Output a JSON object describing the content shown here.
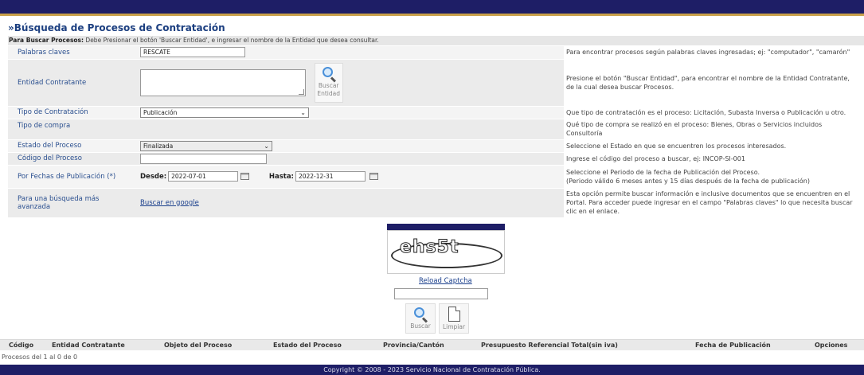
{
  "title": "Búsqueda de Procesos de Contratación",
  "title_prefix": "»",
  "instructions": {
    "bold": "Para Buscar Procesos:",
    "text": " Debe Presionar el botón 'Buscar Entidad', e ingresar el nombre de la Entidad que desea consultar."
  },
  "rows": {
    "palabras": {
      "label": "Palabras claves",
      "value": "RESCATE",
      "help": "Para encontrar procesos según palabras claves ingresadas; ej: \"computador\", \"camarón\""
    },
    "entidad": {
      "label": "Entidad Contratante",
      "button_line1": "Buscar",
      "button_line2": "Entidad",
      "help_line1": "Presione el botón \"Buscar Entidad\", para encontrar el nombre de la Entidad Contratante,",
      "help_line2": "de la cual desea buscar Procesos."
    },
    "tipo_contratacion": {
      "label": "Tipo de Contratación",
      "value": "Publicación",
      "help": "Que tipo de contratación es el proceso: Licitación, Subasta Inversa o Publicación u otro."
    },
    "tipo_compra": {
      "label": "Tipo de compra",
      "help_line1": "Qué tipo de compra se realizó en el proceso: Bienes, Obras o Servicios incluidos",
      "help_line2": "Consultoría"
    },
    "estado": {
      "label": "Estado del Proceso",
      "value": "Finalizada",
      "help": "Seleccione el Estado en que se encuentren los procesos interesados."
    },
    "codigo": {
      "label": "Código del Proceso",
      "value": "",
      "help": "Ingrese el código del proceso a buscar, ej: INCOP-SI-001"
    },
    "fechas": {
      "label": "Por Fechas de Publicación (*)",
      "desde_label": "Desde:",
      "desde_value": "2022-07-01",
      "hasta_label": "Hasta:",
      "hasta_value": "2022-12-31",
      "help_line1": "Seleccione el Periodo de la fecha de Publicación del Proceso.",
      "help_line2": "(Periodo válido 6 meses antes y 15 días después de la fecha de publicación)"
    },
    "avanzada": {
      "label_line1": "Para una búsqueda más",
      "label_line2": "avanzada",
      "link": "Buscar en google",
      "help_line1": "Esta opción permite buscar información e inclusive documentos que se encuentren en el",
      "help_line2": "Portal. Para acceder puede ingresar en el campo \"Palabras claves\" lo que necesita buscar",
      "help_line3": "clic en el enlace."
    }
  },
  "captcha": {
    "text": "ehs5t",
    "reload_label": "Reload Captcha",
    "input_value": ""
  },
  "buttons": {
    "buscar": "Buscar",
    "limpiar": "Limpiar"
  },
  "results": {
    "columns": [
      "Código",
      "Entidad Contratante",
      "Objeto del Proceso",
      "Estado del Proceso",
      "Provincia/Cantón",
      "Presupuesto Referencial Total(sin iva)",
      "Fecha de Publicación",
      "Opciones"
    ],
    "summary": "Procesos del 1 al 0 de 0"
  },
  "footer": "Copyright © 2008 - 2023 Servicio Nacional de Contratación Pública.",
  "colors": {
    "header_bar": "#1e1e66",
    "accent_line": "#c9a04a",
    "title": "#1c3f80",
    "label": "#2a4f8f"
  }
}
